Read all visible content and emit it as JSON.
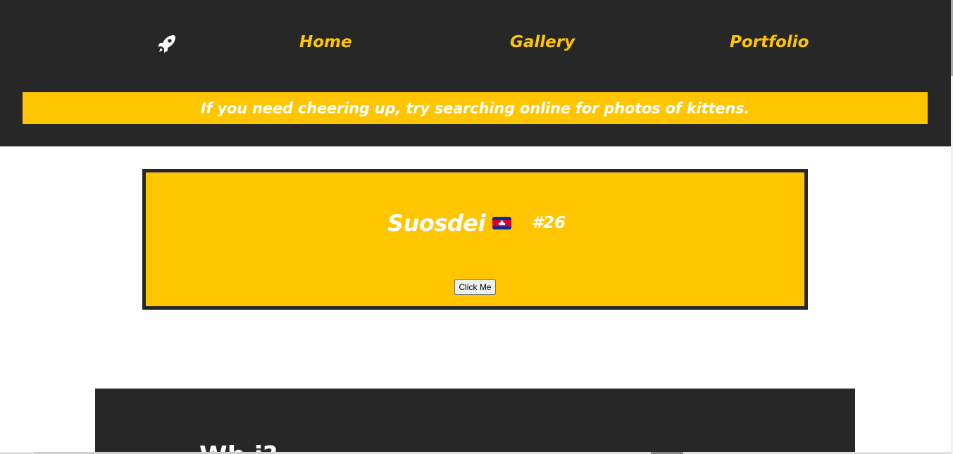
{
  "nav": {
    "logo_icon": "rocket-icon",
    "links": [
      {
        "label": "Home"
      },
      {
        "label": "Gallery"
      },
      {
        "label": "Portfolio"
      }
    ]
  },
  "banner": {
    "text": "If you need cheering up, try searching online for photos of kittens."
  },
  "card": {
    "greeting": "Suosdei",
    "flag_icon": "cambodia-flag-icon",
    "counter": "#26",
    "button_label": "Click Me"
  },
  "section": {
    "heading": "Wh      i?"
  },
  "colors": {
    "dark": "#272727",
    "accent": "#ffc600",
    "text_light": "#ffffff"
  }
}
